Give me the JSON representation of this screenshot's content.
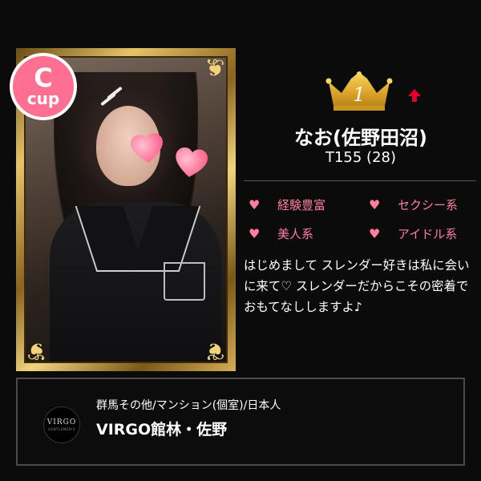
{
  "profile": {
    "cup_letter": "C",
    "cup_unit": "cup",
    "rank": "1",
    "name": "なお(佐野田沼)",
    "stats": "T155 (28)",
    "tags": [
      {
        "icon": "heart-icon",
        "label": "経験豊富"
      },
      {
        "icon": "heart-icon",
        "label": "セクシー系"
      },
      {
        "icon": "heart-icon",
        "label": "美人系"
      },
      {
        "icon": "heart-icon",
        "label": "アイドル系"
      }
    ],
    "description": "はじめまして スレンダー好きは私に会いに来て♡ スレンダーだからこその密着でおもてなししますよ♪"
  },
  "shop": {
    "logo_main": "VIRGO",
    "logo_sub": "GENTLEMEN'S",
    "category": "群馬その他/マンション(個室)/日本人",
    "name": "VIRGO館林・佐野"
  },
  "colors": {
    "accent_pink": "#ff7fa0",
    "badge_pink": "#ff6f92",
    "crown_gold": "#e7b93f",
    "arrow_red": "#e3002b",
    "background": "#0b0b0b"
  },
  "icons": {
    "rank": "crown-icon",
    "trend": "up-arrow-icon",
    "tag": "heart-icon"
  }
}
